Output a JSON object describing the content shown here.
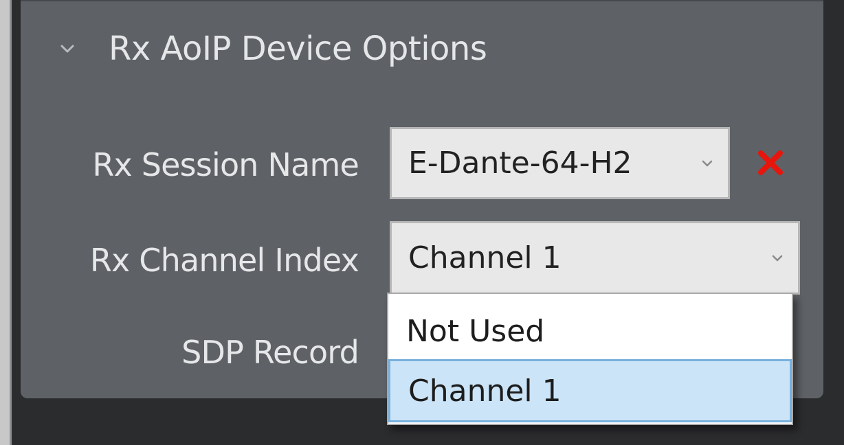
{
  "panel": {
    "title": "Rx AoIP Device Options",
    "expanded_icon": "chevron-down-icon"
  },
  "fields": {
    "session_name": {
      "label": "Rx Session Name",
      "value": "E-Dante-64-H2",
      "remove_icon": "close-icon",
      "remove_color": "#e8150d"
    },
    "channel_index": {
      "label": "Rx Channel Index",
      "value": "Channel 1"
    },
    "sdp_record": {
      "label": "SDP Record"
    }
  },
  "dropdown": {
    "options": [
      {
        "label": "Not Used",
        "selected": false
      },
      {
        "label": "Channel 1",
        "selected": true
      }
    ],
    "highlight_color": "#cce4f7"
  }
}
